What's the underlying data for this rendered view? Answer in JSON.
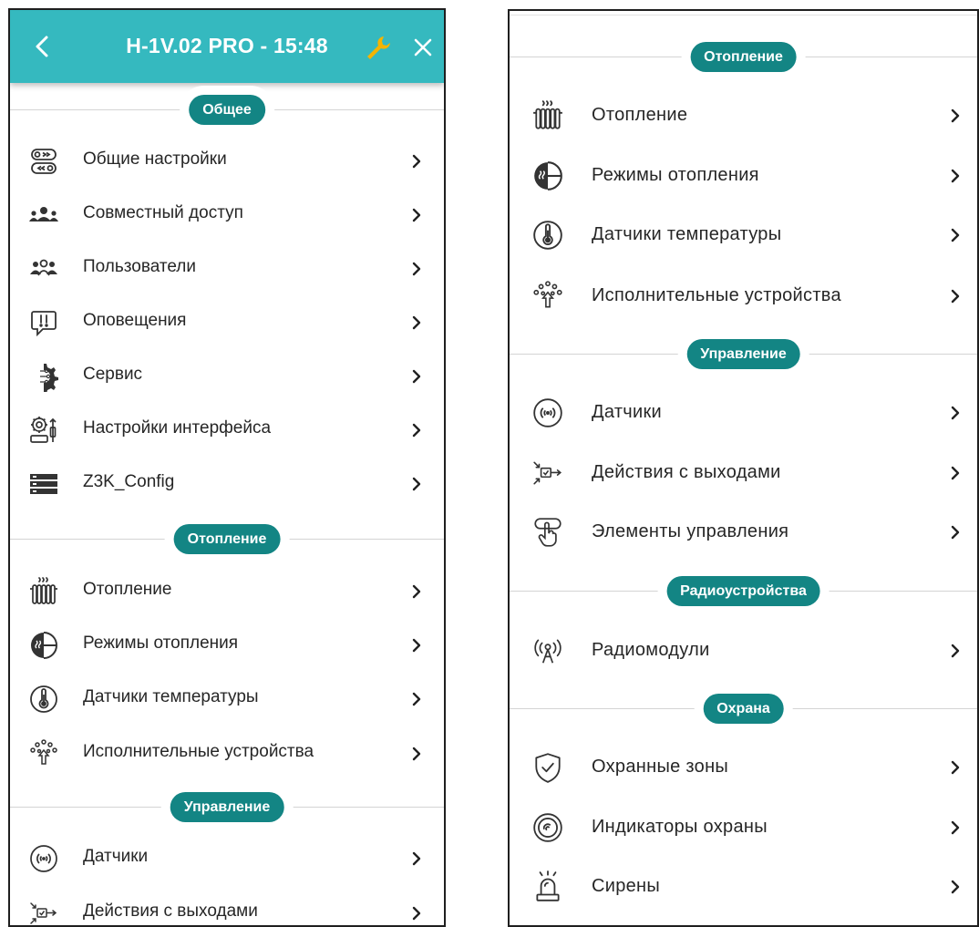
{
  "header": {
    "title": "H-1V.02 PRO - 15:48"
  },
  "left": {
    "sections": {
      "general": "Общее",
      "heating": "Отопление",
      "control": "Управление"
    },
    "general_items": [
      {
        "label": "Общие настройки",
        "icon": "toggle-settings-icon"
      },
      {
        "label": "Совместный доступ",
        "icon": "shared-access-icon"
      },
      {
        "label": "Пользователи",
        "icon": "users-icon"
      },
      {
        "label": "Оповещения",
        "icon": "notification-icon"
      },
      {
        "label": "Сервис",
        "icon": "service-gear-icon"
      },
      {
        "label": "Настройки интерфейса",
        "icon": "interface-settings-icon"
      },
      {
        "label": "Z3K_Config",
        "icon": "config-server-icon"
      }
    ],
    "heating_items": [
      {
        "label": "Отопление",
        "icon": "radiator-icon"
      },
      {
        "label": "Режимы отопления",
        "icon": "heating-modes-icon"
      },
      {
        "label": "Датчики температуры",
        "icon": "thermometer-icon"
      },
      {
        "label": "Исполнительные устройства",
        "icon": "actuators-icon"
      }
    ],
    "control_items": [
      {
        "label": "Датчики",
        "icon": "sensor-icon"
      },
      {
        "label": "Действия с выходами",
        "icon": "output-actions-icon"
      }
    ]
  },
  "right": {
    "sections": {
      "heating": "Отопление",
      "control": "Управление",
      "radio": "Радиоустройства",
      "security": "Охрана"
    },
    "heating_items": [
      {
        "label": "Отопление",
        "icon": "radiator-icon"
      },
      {
        "label": "Режимы отопления",
        "icon": "heating-modes-icon"
      },
      {
        "label": "Датчики температуры",
        "icon": "thermometer-icon"
      },
      {
        "label": "Исполнительные устройства",
        "icon": "actuators-icon"
      }
    ],
    "control_items": [
      {
        "label": "Датчики",
        "icon": "sensor-icon"
      },
      {
        "label": "Действия с выходами",
        "icon": "output-actions-icon"
      },
      {
        "label": "Элементы управления",
        "icon": "touch-control-icon"
      }
    ],
    "radio_items": [
      {
        "label": "Радиомодули",
        "icon": "radio-antenna-icon"
      }
    ],
    "security_items": [
      {
        "label": "Охранные зоны",
        "icon": "shield-check-icon"
      },
      {
        "label": "Индикаторы охраны",
        "icon": "security-indicator-icon"
      },
      {
        "label": "Сирены",
        "icon": "siren-icon"
      }
    ]
  },
  "colors": {
    "header_bg": "#35b9bf",
    "pill_bg": "#138584",
    "wrench": "#f4b400",
    "icon": "#333333"
  }
}
